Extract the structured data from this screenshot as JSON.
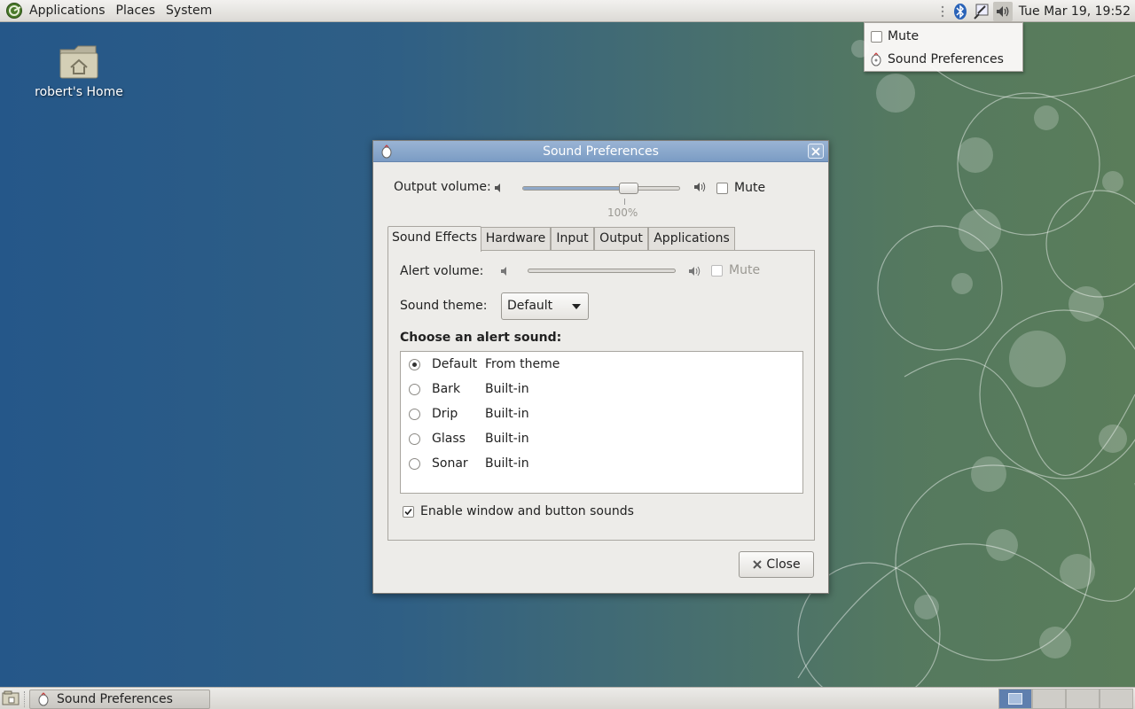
{
  "top_panel": {
    "menus": [
      "Applications",
      "Places",
      "System"
    ],
    "tray_icons": [
      "bluetooth-icon",
      "network-icon",
      "volume-icon"
    ],
    "clock": "Tue Mar 19, 19:52"
  },
  "volume_menu": {
    "mute_label": "Mute",
    "mute_checked": false,
    "prefs_label": "Sound Preferences"
  },
  "desktop": {
    "icons": [
      {
        "label": "robert's Home",
        "icon": "home-folder-icon"
      }
    ]
  },
  "dialog": {
    "title": "Sound Preferences",
    "output_volume_label": "Output volume:",
    "output_volume_value": 0.7,
    "output_volume_mark": "100%",
    "output_mute_label": "Mute",
    "output_mute_checked": false,
    "tabs": [
      "Sound Effects",
      "Hardware",
      "Input",
      "Output",
      "Applications"
    ],
    "active_tab": "Sound Effects",
    "alert_volume_label": "Alert volume:",
    "alert_mute_label": "Mute",
    "alert_mute_checked": false,
    "sound_theme_label": "Sound theme:",
    "sound_theme_value": "Default",
    "choose_label": "Choose an alert sound:",
    "sounds": [
      {
        "name": "Default",
        "source": "From theme",
        "selected": true
      },
      {
        "name": "Bark",
        "source": "Built-in",
        "selected": false
      },
      {
        "name": "Drip",
        "source": "Built-in",
        "selected": false
      },
      {
        "name": "Glass",
        "source": "Built-in",
        "selected": false
      },
      {
        "name": "Sonar",
        "source": "Built-in",
        "selected": false
      }
    ],
    "enable_sounds_label": "Enable window and button sounds",
    "enable_sounds_checked": true,
    "close_label": "Close"
  },
  "bottom_panel": {
    "task_label": "Sound Preferences",
    "workspaces": 4,
    "active_workspace": 1
  },
  "colors": {
    "desktop_left": "#255789",
    "desktop_right": "#5a7d5a",
    "titlebar": "#7b9cc4"
  }
}
